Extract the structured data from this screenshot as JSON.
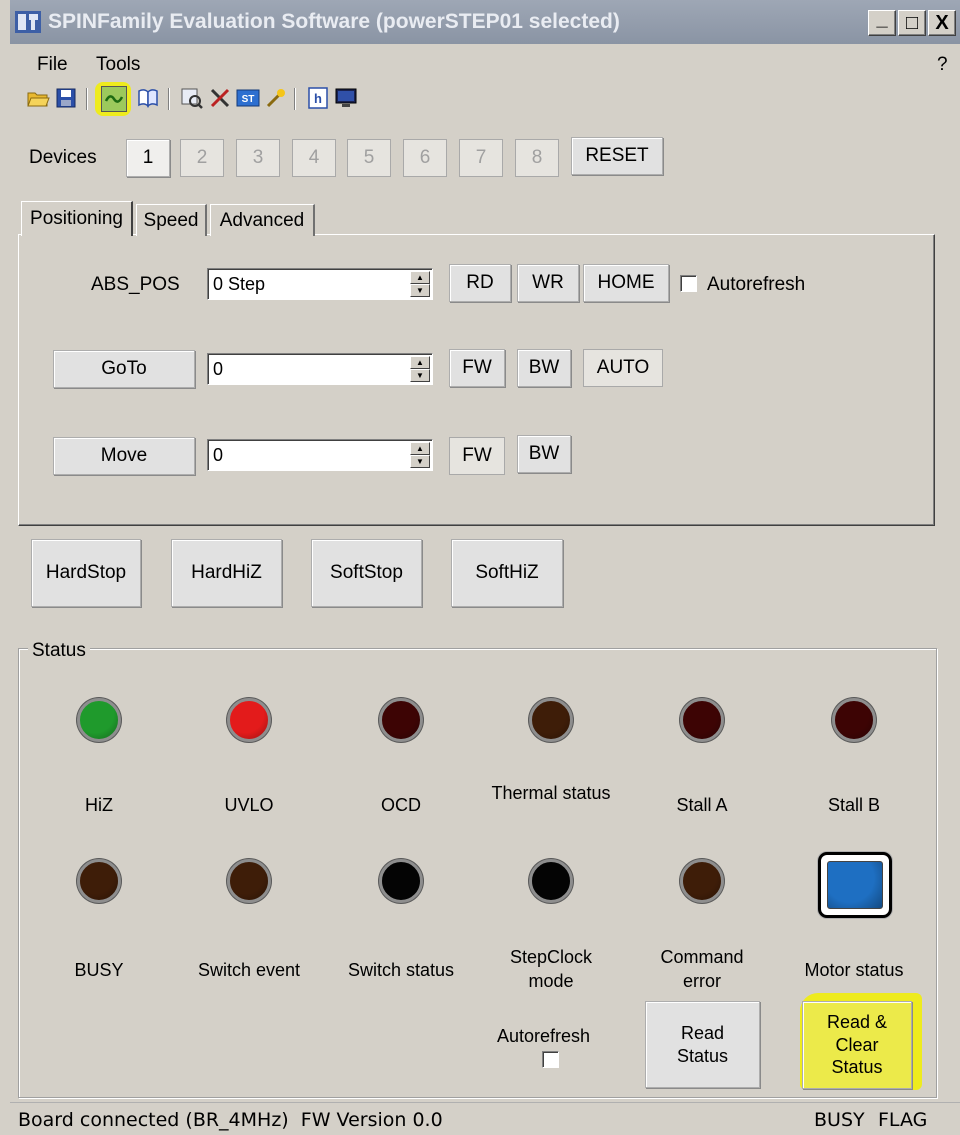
{
  "window": {
    "title": "SPINFamily Evaluation Software (powerSTEP01 selected)",
    "controls": {
      "minimize": "_",
      "maximize": "□",
      "close": "X"
    }
  },
  "menu": {
    "file": "File",
    "tools": "Tools",
    "help": "?"
  },
  "toolbar": {
    "icons": [
      "open-folder-icon",
      "save-icon",
      "connect-icon",
      "book-icon",
      "inspect-icon",
      "tools-icon",
      "st-icon",
      "wand-icon",
      "h-icon",
      "monitor-icon"
    ]
  },
  "devices": {
    "label": "Devices",
    "buttons": [
      "1",
      "2",
      "3",
      "4",
      "5",
      "6",
      "7",
      "8"
    ],
    "reset": "RESET"
  },
  "tabs": [
    "Positioning",
    "Speed",
    "Advanced"
  ],
  "positioning": {
    "abs_pos": {
      "label": "ABS_POS",
      "value": "0 Step",
      "rd": "RD",
      "wr": "WR",
      "home": "HOME",
      "autorefresh": "Autorefresh"
    },
    "goto": {
      "label": "GoTo",
      "value": "0",
      "fw": "FW",
      "bw": "BW",
      "auto": "AUTO"
    },
    "move": {
      "label": "Move",
      "value": "0",
      "fw": "FW",
      "bw": "BW"
    }
  },
  "stops": [
    "HardStop",
    "HardHiZ",
    "SoftStop",
    "SoftHiZ"
  ],
  "status": {
    "title": "Status",
    "row1": [
      {
        "label": "HiZ",
        "color": "#1f9a2c"
      },
      {
        "label": "UVLO",
        "color": "#e31b1b"
      },
      {
        "label": "OCD",
        "color": "#3d0404"
      },
      {
        "label": "Thermal status",
        "color": "#3e1d08"
      },
      {
        "label": "Stall A",
        "color": "#3d0404"
      },
      {
        "label": "Stall B",
        "color": "#3d0404"
      }
    ],
    "row2": [
      {
        "label": "BUSY",
        "color": "#3e1d08"
      },
      {
        "label": "Switch event",
        "color": "#3e1d08"
      },
      {
        "label": "Switch status",
        "color": "#040404"
      },
      {
        "label": "StepClock mode",
        "color": "#040404"
      },
      {
        "label": "Command error",
        "color": "#3e1d08"
      },
      {
        "label": "Motor status",
        "color": "#1e6fc2"
      }
    ],
    "autorefresh": "Autorefresh",
    "read_status": "Read Status",
    "read_clear_status": "Read & Clear Status"
  },
  "statusbar": {
    "left": "Board connected (BR_4MHz)  FW Version 0.0",
    "busy": "BUSY",
    "flag": "FLAG"
  },
  "colors": {
    "highlight": "#f2f000",
    "window_bg": "#d4d0c8",
    "titlebar": "#8f99a8"
  }
}
